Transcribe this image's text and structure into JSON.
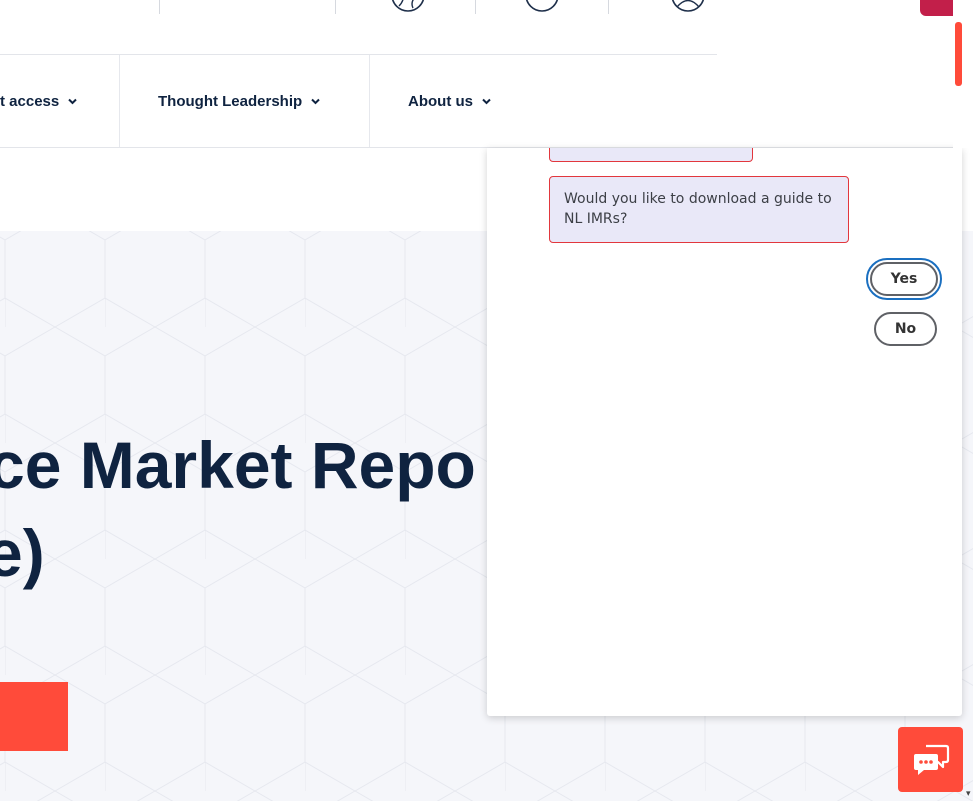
{
  "top_bar": {
    "icons": [
      "globe-icon",
      "calendar-icon",
      "user-account-icon"
    ]
  },
  "nav": {
    "items": [
      {
        "label": "t access"
      },
      {
        "label": "Thought Leadership"
      },
      {
        "label": "About us"
      }
    ]
  },
  "hero": {
    "title_line1": "ce Market Repo",
    "title_line2": "e)",
    "accent_color": "#ff4b3a",
    "text_color": "#0f2340"
  },
  "chat": {
    "message": "Would you like to download a guide to NL IMRs?",
    "quick_replies": {
      "yes": "Yes",
      "no": "No"
    },
    "bubble_color": "#e9e8f8",
    "bubble_border": "#e2373d",
    "focus_color": "#1a6fc0"
  },
  "launcher": {
    "icon": "chat-bubbles-icon",
    "color": "#ff4b3a"
  }
}
